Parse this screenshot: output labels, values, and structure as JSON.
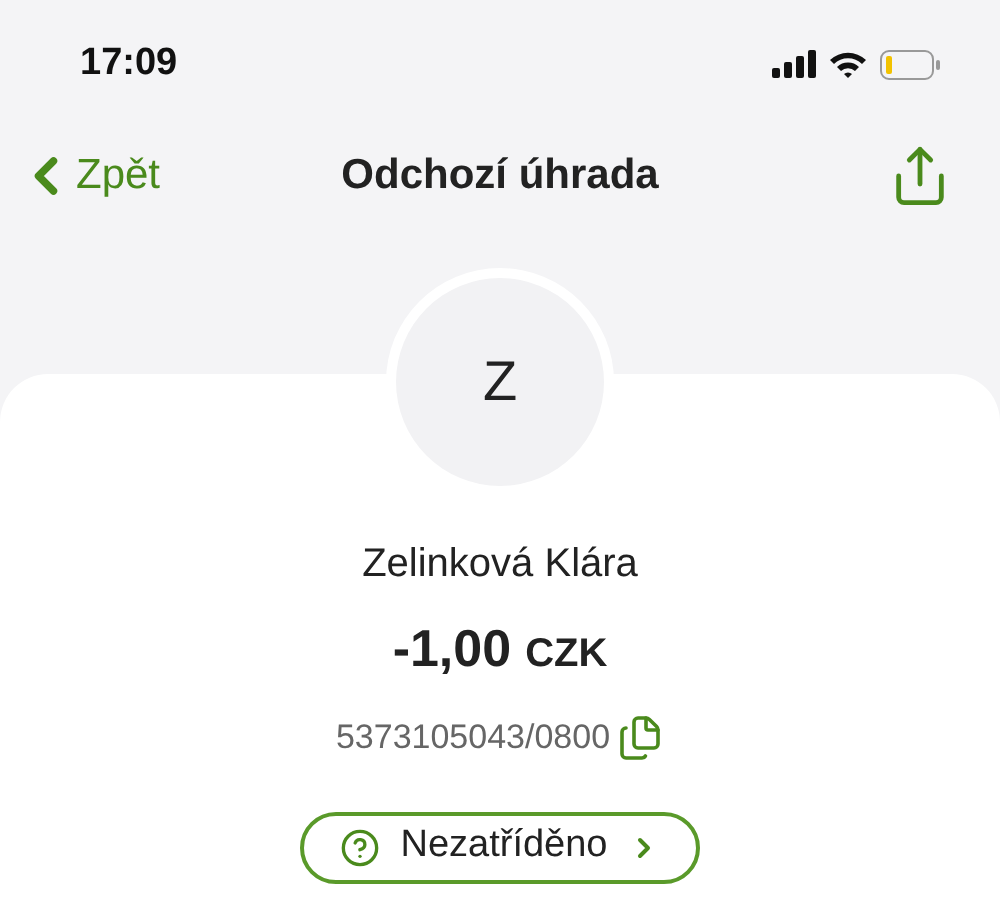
{
  "status_bar": {
    "time": "17:09"
  },
  "nav": {
    "back": "Zpět",
    "title": "Odchozí úhrada"
  },
  "avatar": {
    "initial": "Z"
  },
  "payment": {
    "name": "Zelinková Klára",
    "amount": "-1,00",
    "currency": "CZK",
    "account": "5373105043/0800"
  },
  "category": {
    "label": "Nezatříděno"
  }
}
